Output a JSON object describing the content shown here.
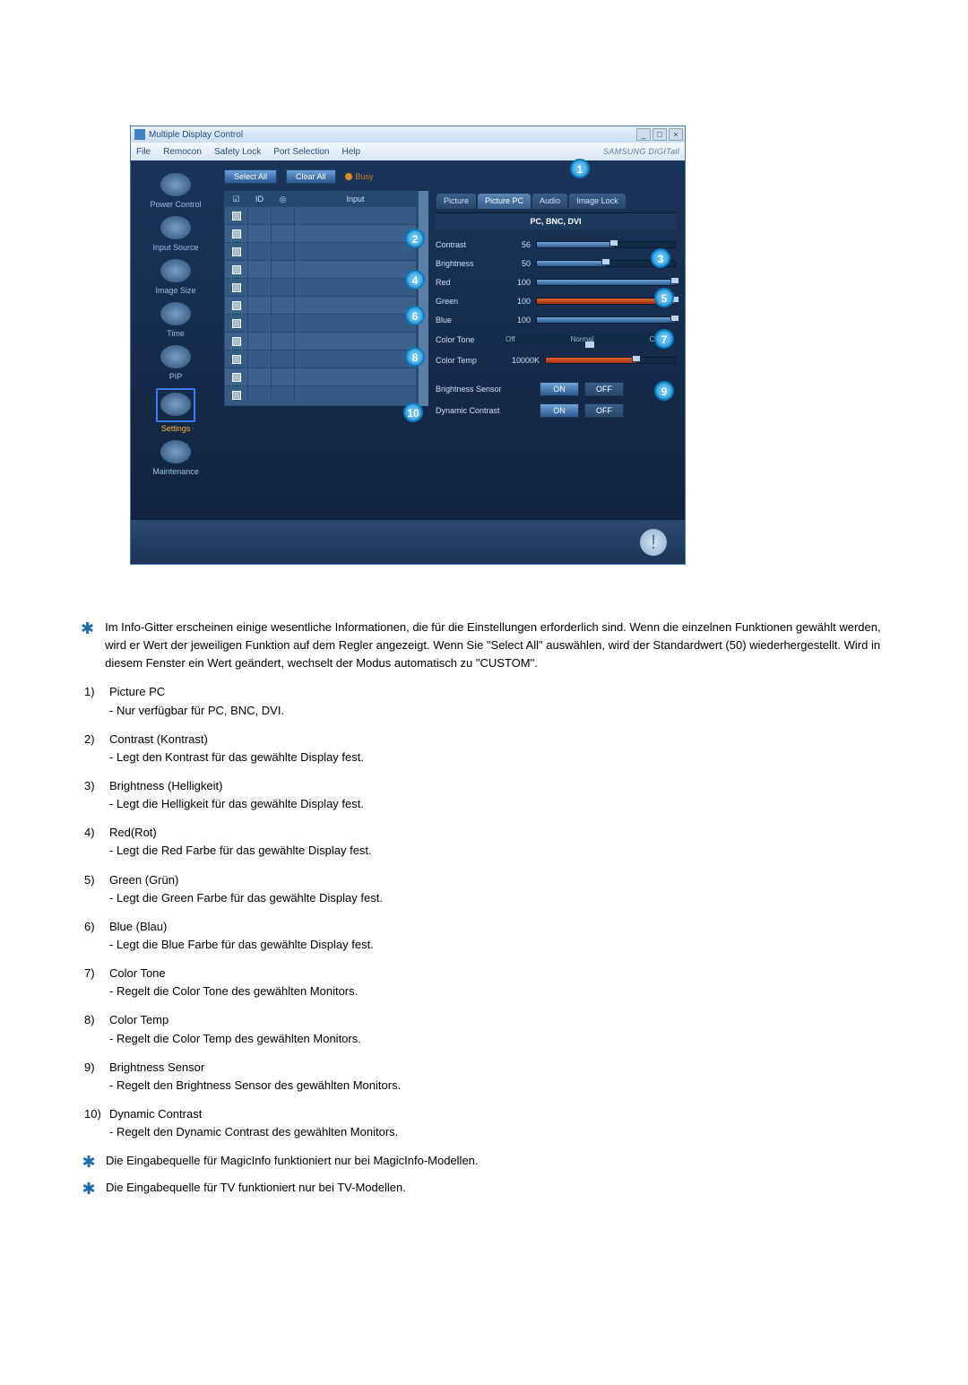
{
  "app": {
    "title": "Multiple Display Control",
    "brand": "SAMSUNG DIGITall",
    "menu": [
      "File",
      "Remocon",
      "Safety Lock",
      "Port Selection",
      "Help"
    ],
    "sidebar": [
      {
        "label": "Power Control"
      },
      {
        "label": "Input Source"
      },
      {
        "label": "Image Size"
      },
      {
        "label": "Time"
      },
      {
        "label": "PIP"
      },
      {
        "label": "Settings",
        "selected": true
      },
      {
        "label": "Maintenance"
      }
    ],
    "toolbar": {
      "select_all": "Select All",
      "clear_all": "Clear All",
      "busy": "Busy"
    },
    "grid": {
      "headers": [
        "☑",
        "ID",
        "◎",
        "Input"
      ]
    },
    "panel": {
      "tabs": [
        "Picture",
        "Picture PC",
        "Audio",
        "Image Lock"
      ],
      "active_tab": 1,
      "mode": "PC, BNC, DVI",
      "contrast": {
        "label": "Contrast",
        "value": "56"
      },
      "brightness": {
        "label": "Brightness",
        "value": "50"
      },
      "red": {
        "label": "Red",
        "value": "100"
      },
      "green": {
        "label": "Green",
        "value": "100"
      },
      "blue": {
        "label": "Blue",
        "value": "100"
      },
      "color_tone": {
        "label": "Color Tone",
        "opts": [
          "Off",
          "Normal",
          "Custom"
        ]
      },
      "color_temp": {
        "label": "Color Temp",
        "value": "10000K"
      },
      "brightness_sensor": {
        "label": "Brightness Sensor",
        "on": "ON",
        "off": "OFF"
      },
      "dynamic_contrast": {
        "label": "Dynamic Contrast",
        "on": "ON",
        "off": "OFF"
      }
    },
    "callouts": [
      "1",
      "2",
      "3",
      "4",
      "5",
      "6",
      "7",
      "8",
      "9",
      "10"
    ]
  },
  "note_main": "Im Info-Gitter erscheinen einige wesentliche Informationen, die für die Einstellungen erforderlich sind. Wenn die einzelnen Funktionen gewählt werden, wird er Wert der jeweiligen Funktion auf dem Regler angezeigt. Wenn Sie \"Select All\" auswählen, wird der Standardwert (50) wiederhergestellt. Wird in diesem Fenster ein Wert geändert, wechselt der Modus automatisch zu \"CUSTOM\".",
  "list": [
    {
      "n": "1)",
      "title": "Picture PC",
      "sub": "- Nur verfügbar für PC, BNC, DVI."
    },
    {
      "n": "2)",
      "title": "Contrast (Kontrast)",
      "sub": "- Legt den Kontrast für das gewählte Display fest."
    },
    {
      "n": "3)",
      "title": "Brightness (Helligkeit)",
      "sub": "- Legt die Helligkeit für das gewählte Display fest."
    },
    {
      "n": "4)",
      "title": "Red(Rot)",
      "sub": "- Legt die Red Farbe für das gewählte Display fest."
    },
    {
      "n": "5)",
      "title": "Green (Grün)",
      "sub": "- Legt die Green Farbe für das gewählte Display fest."
    },
    {
      "n": "6)",
      "title": "Blue (Blau)",
      "sub": "- Legt die Blue Farbe für das gewählte Display fest."
    },
    {
      "n": "7)",
      "title": "Color Tone",
      "sub": "- Regelt die Color Tone des gewählten Monitors."
    },
    {
      "n": "8)",
      "title": "Color Temp",
      "sub": "- Regelt die Color Temp des gewählten Monitors."
    },
    {
      "n": "9)",
      "title": "Brightness Sensor",
      "sub": "- Regelt den Brightness Sensor des gewählten Monitors."
    },
    {
      "n": "10)",
      "title": "Dynamic Contrast",
      "sub": "- Regelt den Dynamic Contrast des gewählten Monitors."
    }
  ],
  "footnotes": [
    "Die Eingabequelle für MagicInfo funktioniert nur bei MagicInfo-Modellen.",
    "Die Eingabequelle für TV funktioniert nur bei TV-Modellen."
  ]
}
